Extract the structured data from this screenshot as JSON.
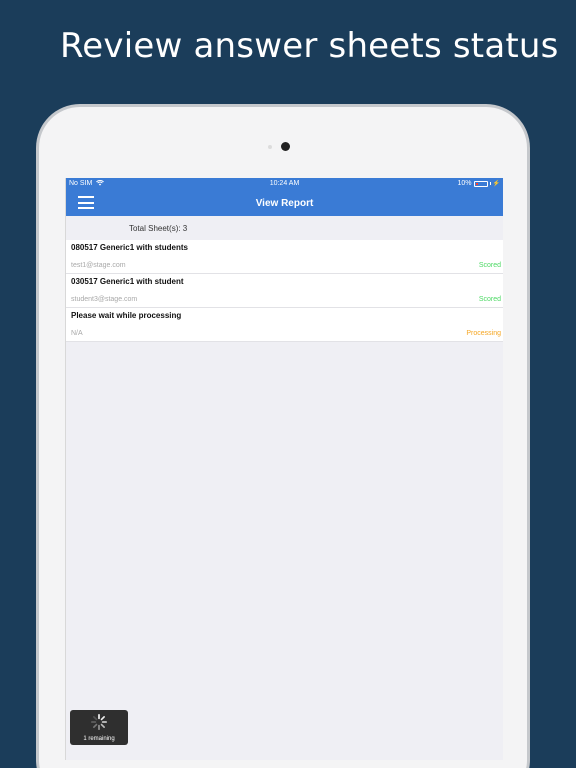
{
  "headline": "Review answer sheets status",
  "status_bar": {
    "carrier": "No SIM",
    "time": "10:24 AM",
    "battery": "10%"
  },
  "nav": {
    "title": "View Report"
  },
  "summary": {
    "total_label": "Total Sheet(s): 3"
  },
  "sheets": [
    {
      "title": "080517 Generic1 with students",
      "email": "test1@stage.com",
      "status": "Scored",
      "status_color": "#4cd964"
    },
    {
      "title": "030517 Generic1 with student",
      "email": "student3@stage.com",
      "status": "Scored",
      "status_color": "#4cd964"
    },
    {
      "title": "Please wait while processing",
      "email": "N/A",
      "status": "Processing",
      "status_color": "#f5a623"
    }
  ],
  "toast": {
    "label": "1 remaining"
  },
  "colors": {
    "background": "#1b3d5a",
    "nav_accent": "#3a7bd5",
    "scored": "#4cd964",
    "processing": "#f5a623"
  },
  "icons": {
    "menu": "hamburger-menu-icon",
    "wifi": "wifi-icon",
    "battery": "battery-icon",
    "spinner": "loading-spinner-icon"
  }
}
